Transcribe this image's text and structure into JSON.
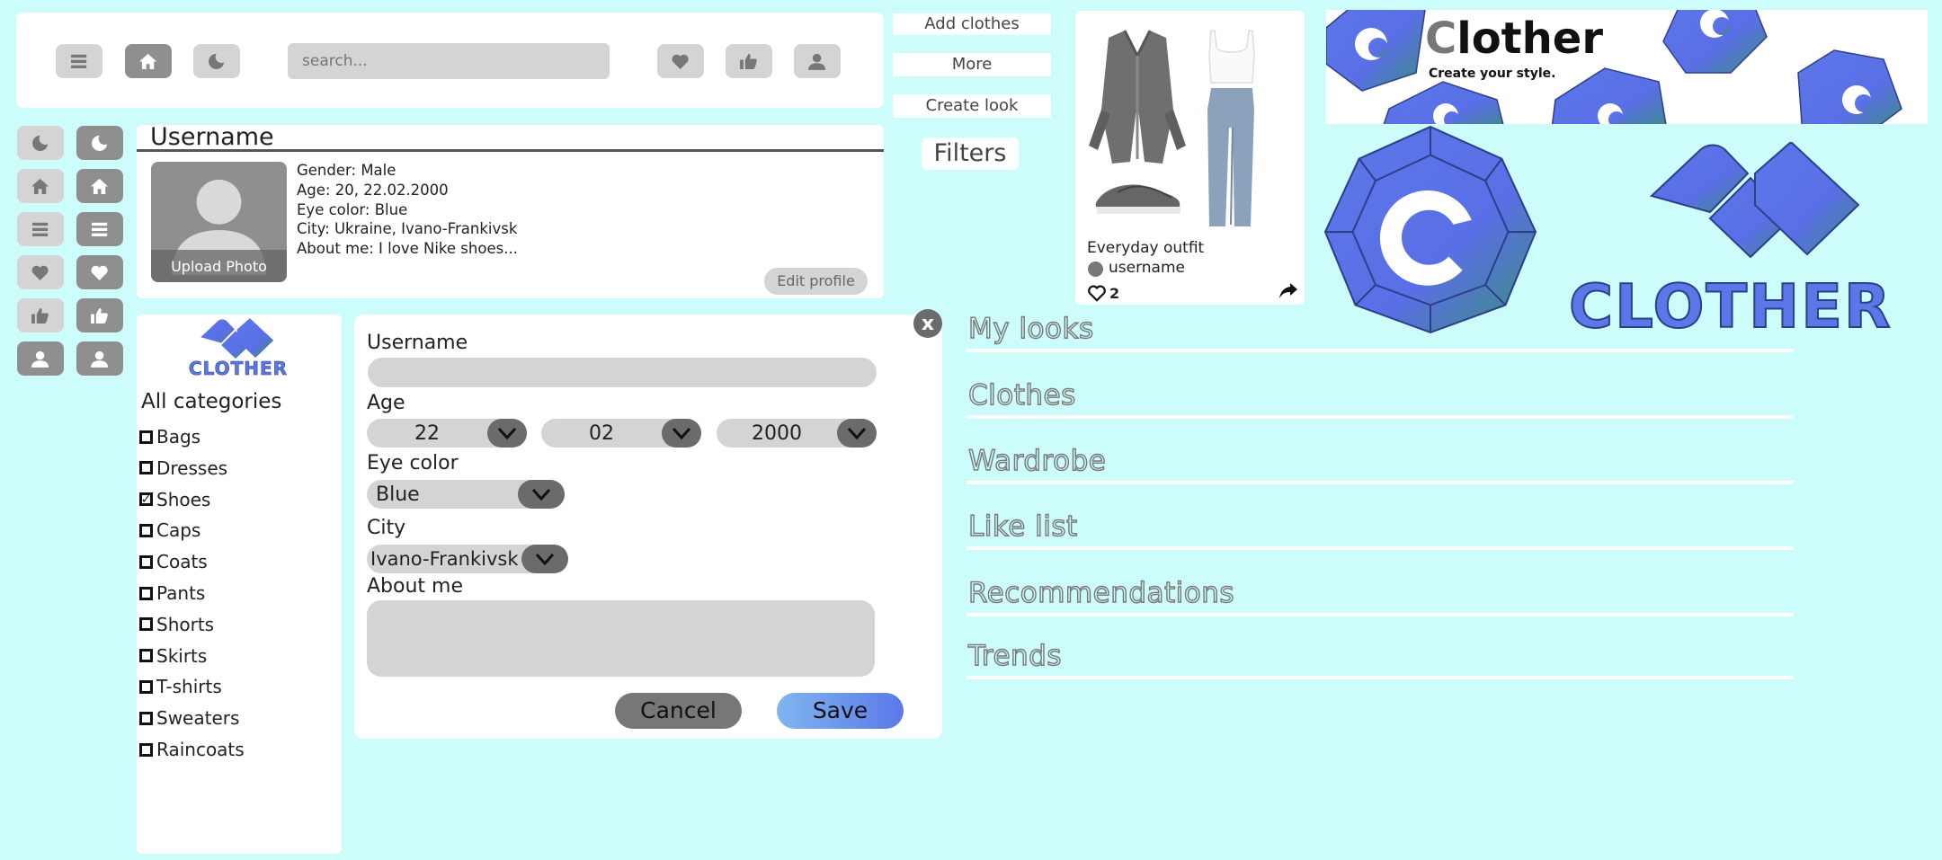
{
  "top_bar": {
    "search_placeholder": "search...",
    "icons": [
      "menu-icon",
      "home-icon",
      "moon-icon",
      "heart-icon",
      "thumbs-up-icon",
      "user-icon"
    ]
  },
  "side_actions": {
    "add_clothes": "Add clothes",
    "more": "More",
    "create_look": "Create look",
    "filters": "Filters"
  },
  "profile": {
    "username": "Username",
    "gender": "Gender: Male",
    "age": "Age: 20, 22.02.2000",
    "eye_color": "Eye color: Blue",
    "city": "City: Ukraine, Ivano-Frankivsk",
    "about": "About me: I love Nike shoes...",
    "upload_photo": "Upload Photo",
    "edit_profile": "Edit profile"
  },
  "outfit_card": {
    "title": "Everyday outfit",
    "user": "username",
    "likes": "2"
  },
  "banner": {
    "brand_first": "C",
    "brand_rest": "lother",
    "tagline": "Create your style."
  },
  "logo": {
    "wordmark": "CLOTHER"
  },
  "categories": {
    "title": "All categories",
    "items": [
      {
        "label": "Bags",
        "checked": false
      },
      {
        "label": "Dresses",
        "checked": false
      },
      {
        "label": "Shoes",
        "checked": true
      },
      {
        "label": "Caps",
        "checked": false
      },
      {
        "label": "Coats",
        "checked": false
      },
      {
        "label": "Pants",
        "checked": false
      },
      {
        "label": "Shorts",
        "checked": false
      },
      {
        "label": "Skirts",
        "checked": false
      },
      {
        "label": "T-shirts",
        "checked": false
      },
      {
        "label": "Sweaters",
        "checked": false
      },
      {
        "label": "Raincoats",
        "checked": false
      }
    ]
  },
  "edit_form": {
    "close": "x",
    "username_label": "Username",
    "username_value": "",
    "age_label": "Age",
    "day": "22",
    "month": "02",
    "year": "2000",
    "eye_label": "Eye color",
    "eye_value": "Blue",
    "city_label": "City",
    "city_value": "Ivano-Frankivsk",
    "about_label": "About me",
    "about_value": "",
    "cancel": "Cancel",
    "save": "Save"
  },
  "menu": {
    "items": [
      "My looks",
      "Clothes",
      "Wardrobe",
      "Like list",
      "Recommendations",
      "Trends"
    ]
  },
  "colors": {
    "background": "#ccfdfb",
    "accent_blue": "#5b78e8",
    "accent_teal": "#3a8f7a",
    "button_gray": "#d4d4d4",
    "button_dark": "#8f8f8f"
  }
}
